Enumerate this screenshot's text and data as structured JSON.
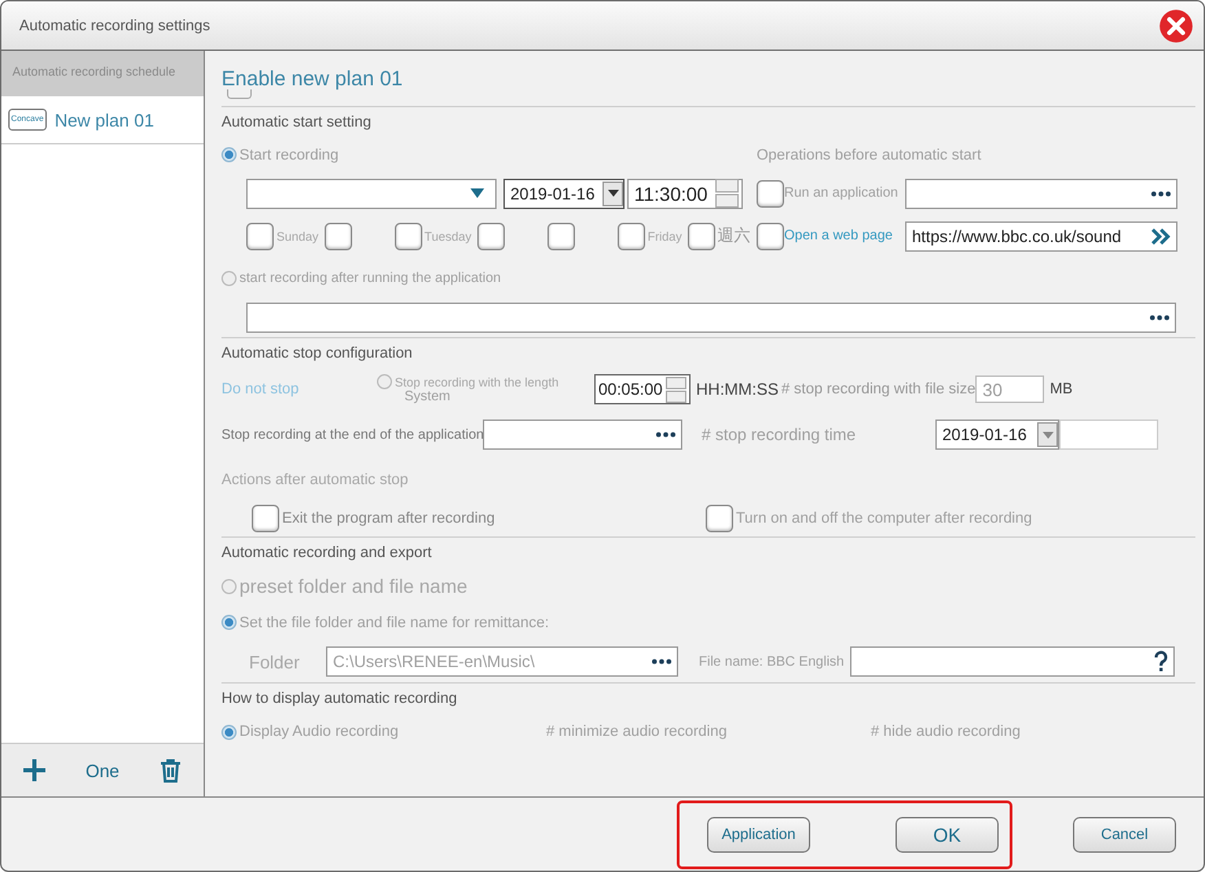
{
  "window": {
    "title": "Automatic recording settings"
  },
  "sidebar": {
    "header": "Automatic recording schedule",
    "items": [
      {
        "icon_text": "Concave",
        "label": "New plan 01",
        "selected": true
      }
    ],
    "add_label": "One"
  },
  "plan": {
    "enable_label": "Enable new plan 01",
    "enabled": false
  },
  "start": {
    "heading": "Automatic start setting",
    "options": [
      {
        "label": "Start recording",
        "selected": true
      },
      {
        "label": "start recording after running the application",
        "selected": false
      }
    ],
    "date": "2019-01-16",
    "time": "11:30:00",
    "days": [
      {
        "label": "Sunday",
        "checked": false
      },
      {
        "checked": false
      },
      {
        "label": "Tuesday",
        "checked": false
      },
      {
        "checked": false
      },
      {
        "checked": false
      },
      {
        "label": "Friday",
        "checked": false
      },
      {
        "label": "週六",
        "checked": false
      }
    ]
  },
  "pre_start": {
    "heading": "Operations before automatic start",
    "items": [
      {
        "kind": "app",
        "label": "Run an application",
        "checked": false
      },
      {
        "kind": "link",
        "label": "Open a web page",
        "checked": false,
        "value": "https://www.bbc.co.uk/sound"
      }
    ]
  },
  "stop": {
    "heading": "Automatic stop configuration",
    "no_stop": "Do not stop",
    "length_option": {
      "label": "Stop recording with the length",
      "selected": false
    },
    "system_label": "System",
    "duration": "00:05:00",
    "duration_unit": "HH:MM:SS",
    "size_label": "# stop recording with file size",
    "size": "30",
    "size_unit": "MB",
    "app_end_label": "Stop recording at the end of the application",
    "time_label": "# stop recording time",
    "date": "2019-01-16"
  },
  "after_stop": {
    "heading": "Actions after automatic stop",
    "items": [
      {
        "label": "Exit the program after recording",
        "checked": false
      },
      {
        "label": "Turn on and off the computer after recording",
        "checked": false
      }
    ]
  },
  "export": {
    "heading": "Automatic recording and export",
    "options": [
      {
        "label": "preset folder and file name",
        "selected": false
      },
      {
        "label": "Set the file folder and file name for remittance:",
        "selected": true
      }
    ],
    "folder_label": "Folder",
    "folder": "C:\\Users\\RENEE-en\\Music\\",
    "file_name": "File name: BBC English"
  },
  "display": {
    "heading": "How to display automatic recording",
    "options": [
      {
        "label": "Display Audio recording",
        "selected": true
      },
      {
        "label": "# minimize audio recording",
        "selected": false
      },
      {
        "label": "# hide audio recording",
        "selected": false
      }
    ]
  },
  "buttons": {
    "framed": [
      {
        "label": "Application"
      },
      {
        "label": "OK"
      }
    ],
    "others": [
      {
        "label": "Cancel"
      }
    ]
  }
}
